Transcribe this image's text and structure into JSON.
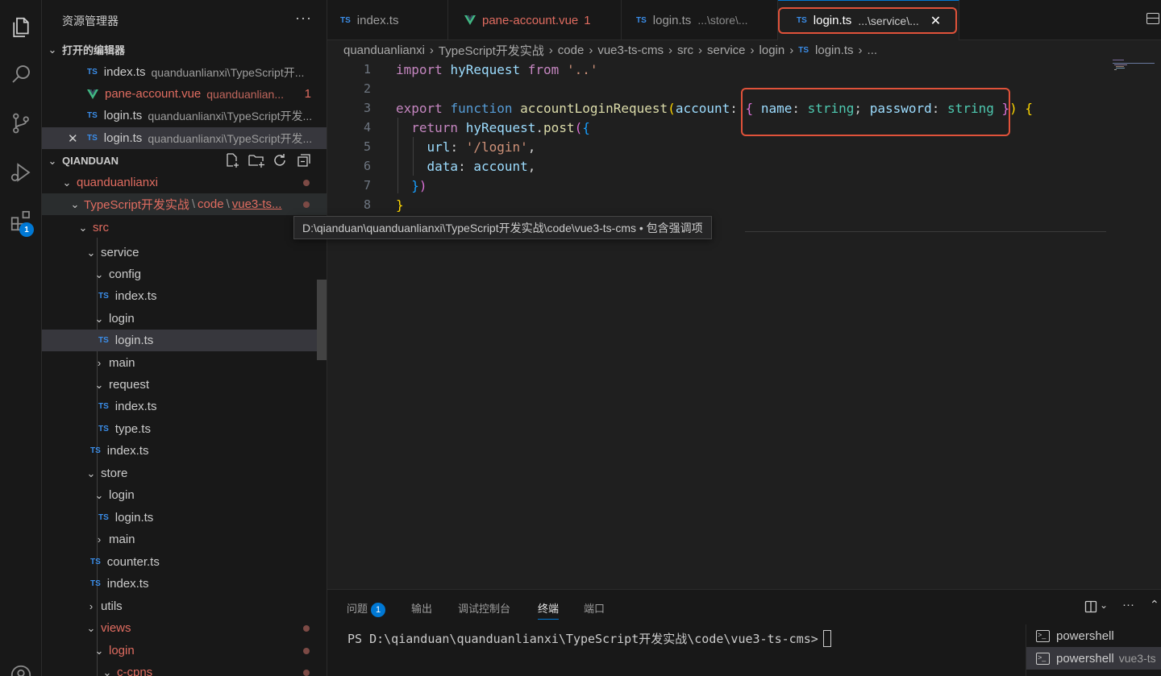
{
  "explorer": {
    "title": "资源管理器",
    "more": "···",
    "open_editors": {
      "header": "打开的编辑器",
      "items": [
        {
          "icon": "TS",
          "name": "index.ts",
          "desc": "quanduanlianxi\\TypeScript开..."
        },
        {
          "icon": "vue",
          "name": "pane-account.vue",
          "desc": "quanduanlian...",
          "badge": "1"
        },
        {
          "icon": "TS",
          "name": "login.ts",
          "desc": "quanduanlianxi\\TypeScript开发..."
        },
        {
          "icon": "TS",
          "name": "login.ts",
          "desc": "quanduanlianxi\\TypeScript开发...",
          "close": "✕"
        }
      ]
    },
    "workspace": {
      "header": "QIANDUAN",
      "tree": [
        {
          "label": "quanduanlianxi"
        },
        {
          "label": "TypeScript开发实战",
          "sep1": "\\",
          "label2": "code",
          "sep2": "\\",
          "label3": "vue3-ts..."
        },
        {
          "label": "src"
        },
        {
          "label": "service"
        },
        {
          "label": "config"
        },
        {
          "label": "index.ts"
        },
        {
          "label": "login"
        },
        {
          "label": "login.ts"
        },
        {
          "label": "main"
        },
        {
          "label": "request"
        },
        {
          "label": "index.ts"
        },
        {
          "label": "type.ts"
        },
        {
          "label": "index.ts"
        },
        {
          "label": "store"
        },
        {
          "label": "login"
        },
        {
          "label": "login.ts"
        },
        {
          "label": "main"
        },
        {
          "label": "counter.ts"
        },
        {
          "label": "index.ts"
        },
        {
          "label": "utils"
        },
        {
          "label": "views"
        },
        {
          "label": "login"
        },
        {
          "label": "c-cpns"
        }
      ]
    }
  },
  "activity_bar": {
    "extensions_badge": "1"
  },
  "tabs": [
    {
      "icon": "TS",
      "name": "index.ts",
      "desc": ""
    },
    {
      "icon": "vue",
      "name": "pane-account.vue",
      "desc": "",
      "badge": "1"
    },
    {
      "icon": "TS",
      "name": "login.ts",
      "desc": "...\\store\\..."
    },
    {
      "icon": "TS",
      "name": "login.ts",
      "desc": "...\\service\\...",
      "close": "✕"
    }
  ],
  "breadcrumb": [
    "quanduanlianxi",
    "TypeScript开发实战",
    "code",
    "vue3-ts-cms",
    "src",
    "service",
    "login",
    "login.ts",
    "..."
  ],
  "breadcrumb_ts_icon": "TS",
  "editor": {
    "line_numbers": [
      "1",
      "2",
      "3",
      "4",
      "5",
      "6",
      "7",
      "8"
    ],
    "tokens": {
      "l1": {
        "import": "import",
        "id": "hyRequest",
        "from": "from",
        "str": "'..'"
      },
      "l3": {
        "export": "export",
        "function": "function",
        "name": "accountLoginRequest",
        "p_open": "(",
        "param": "account",
        "colon": ":",
        "b_open": "{",
        "k1": "name",
        "t1": "string",
        "semi": ";",
        "k2": "password",
        "t2": "string",
        "b_close": "}",
        "p_close": ")",
        "body_open": "{"
      },
      "l4": {
        "return": "return",
        "obj": "hyRequest",
        "method": "post",
        "p_open": "(",
        "b_open": "{"
      },
      "l5": {
        "key": "url",
        "colon": ":",
        "str": "'/login'",
        "comma": ","
      },
      "l6": {
        "key": "data",
        "colon": ":",
        "val": "account",
        "comma": ","
      },
      "l7": {
        "b_close": "}",
        "p_close": ")"
      },
      "l8": {
        "b_close": "}"
      }
    }
  },
  "tooltip": "D:\\qianduan\\quanduanlianxi\\TypeScript开发实战\\code\\vue3-ts-cms • 包含强调项",
  "panel": {
    "tabs": [
      {
        "label": "问题",
        "badge": "1"
      },
      {
        "label": "输出"
      },
      {
        "label": "调试控制台"
      },
      {
        "label": "终端"
      },
      {
        "label": "端口"
      }
    ],
    "more": "···",
    "terminal_prompt": "PS D:\\qianduan\\quanduanlianxi\\TypeScript开发实战\\code\\vue3-ts-cms>",
    "terminals": [
      {
        "name": "powershell",
        "desc": ""
      },
      {
        "name": "powershell",
        "desc": "vue3-ts"
      }
    ]
  },
  "colors": {
    "accent": "#0078d4",
    "highlight_box": "#e0523a",
    "modified": "#e06c60"
  }
}
